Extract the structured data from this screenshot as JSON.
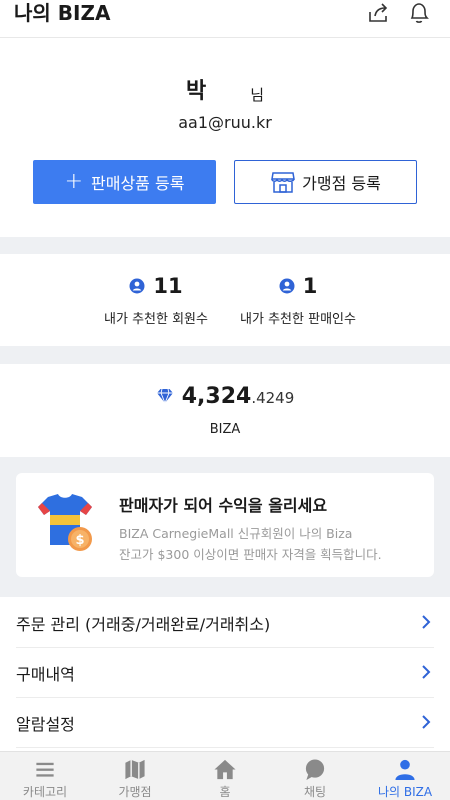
{
  "header": {
    "title": "나의 BIZA",
    "share_icon": "share-icon",
    "bell_icon": "bell-icon"
  },
  "profile": {
    "name": "박",
    "suffix": "님",
    "email": "aa1@ruu.kr",
    "sell_button": "판매상품 등록",
    "store_button": "가맹점 등록"
  },
  "stats": {
    "members": {
      "value": "11",
      "label": "내가 추천한 회원수"
    },
    "sellers": {
      "value": "1",
      "label": "내가 추천한 판매인수"
    }
  },
  "balance": {
    "integer": "4,324",
    "decimal": ".4249",
    "unit": "BIZA"
  },
  "promo": {
    "title": "판매자가 되어 수익을 올리세요",
    "desc_line1": "BIZA CarnegieMall 신규회원이 나의 Biza",
    "desc_line2": "잔고가 $300 이상이면 판매자 자격을 획득합니다."
  },
  "menu": {
    "items": [
      {
        "label": "주문 관리 (거래중/거래완료/거래취소)"
      },
      {
        "label": "구매내역"
      },
      {
        "label": "알람설정"
      }
    ]
  },
  "tabs": [
    {
      "label": "카테고리",
      "icon": "menu-icon"
    },
    {
      "label": "가맹점",
      "icon": "map-icon"
    },
    {
      "label": "홈",
      "icon": "home-icon"
    },
    {
      "label": "채팅",
      "icon": "chat-icon"
    },
    {
      "label": "나의 BIZA",
      "icon": "user-icon",
      "active": true
    }
  ],
  "colors": {
    "accent": "#3d7cf0",
    "active_tab": "#2f6ee6",
    "divider": "#eef0f3"
  }
}
